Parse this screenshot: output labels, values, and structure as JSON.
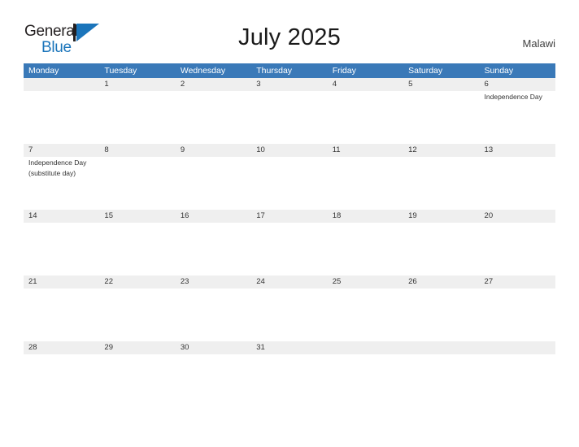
{
  "logo": {
    "word1": "General",
    "word2": "Blue",
    "mark": "triangle-logo-mark"
  },
  "header": {
    "title": "July 2025",
    "country": "Malawi"
  },
  "colors": {
    "header_blue": "#3a79b8",
    "band_gray": "#efefef",
    "logo_blue": "#1b75bb",
    "text_dark": "#333333"
  },
  "calendar": {
    "weekdays": [
      "Monday",
      "Tuesday",
      "Wednesday",
      "Thursday",
      "Friday",
      "Saturday",
      "Sunday"
    ],
    "weeks": [
      {
        "days": [
          {
            "num": "",
            "events": []
          },
          {
            "num": "1",
            "events": []
          },
          {
            "num": "2",
            "events": []
          },
          {
            "num": "3",
            "events": []
          },
          {
            "num": "4",
            "events": []
          },
          {
            "num": "5",
            "events": []
          },
          {
            "num": "6",
            "events": [
              "Independence Day"
            ]
          }
        ]
      },
      {
        "days": [
          {
            "num": "7",
            "events": [
              "Independence Day",
              "(substitute day)"
            ]
          },
          {
            "num": "8",
            "events": []
          },
          {
            "num": "9",
            "events": []
          },
          {
            "num": "10",
            "events": []
          },
          {
            "num": "11",
            "events": []
          },
          {
            "num": "12",
            "events": []
          },
          {
            "num": "13",
            "events": []
          }
        ]
      },
      {
        "days": [
          {
            "num": "14",
            "events": []
          },
          {
            "num": "15",
            "events": []
          },
          {
            "num": "16",
            "events": []
          },
          {
            "num": "17",
            "events": []
          },
          {
            "num": "18",
            "events": []
          },
          {
            "num": "19",
            "events": []
          },
          {
            "num": "20",
            "events": []
          }
        ]
      },
      {
        "days": [
          {
            "num": "21",
            "events": []
          },
          {
            "num": "22",
            "events": []
          },
          {
            "num": "23",
            "events": []
          },
          {
            "num": "24",
            "events": []
          },
          {
            "num": "25",
            "events": []
          },
          {
            "num": "26",
            "events": []
          },
          {
            "num": "27",
            "events": []
          }
        ]
      },
      {
        "days": [
          {
            "num": "28",
            "events": []
          },
          {
            "num": "29",
            "events": []
          },
          {
            "num": "30",
            "events": []
          },
          {
            "num": "31",
            "events": []
          },
          {
            "num": "",
            "events": []
          },
          {
            "num": "",
            "events": []
          },
          {
            "num": "",
            "events": []
          }
        ]
      }
    ]
  }
}
